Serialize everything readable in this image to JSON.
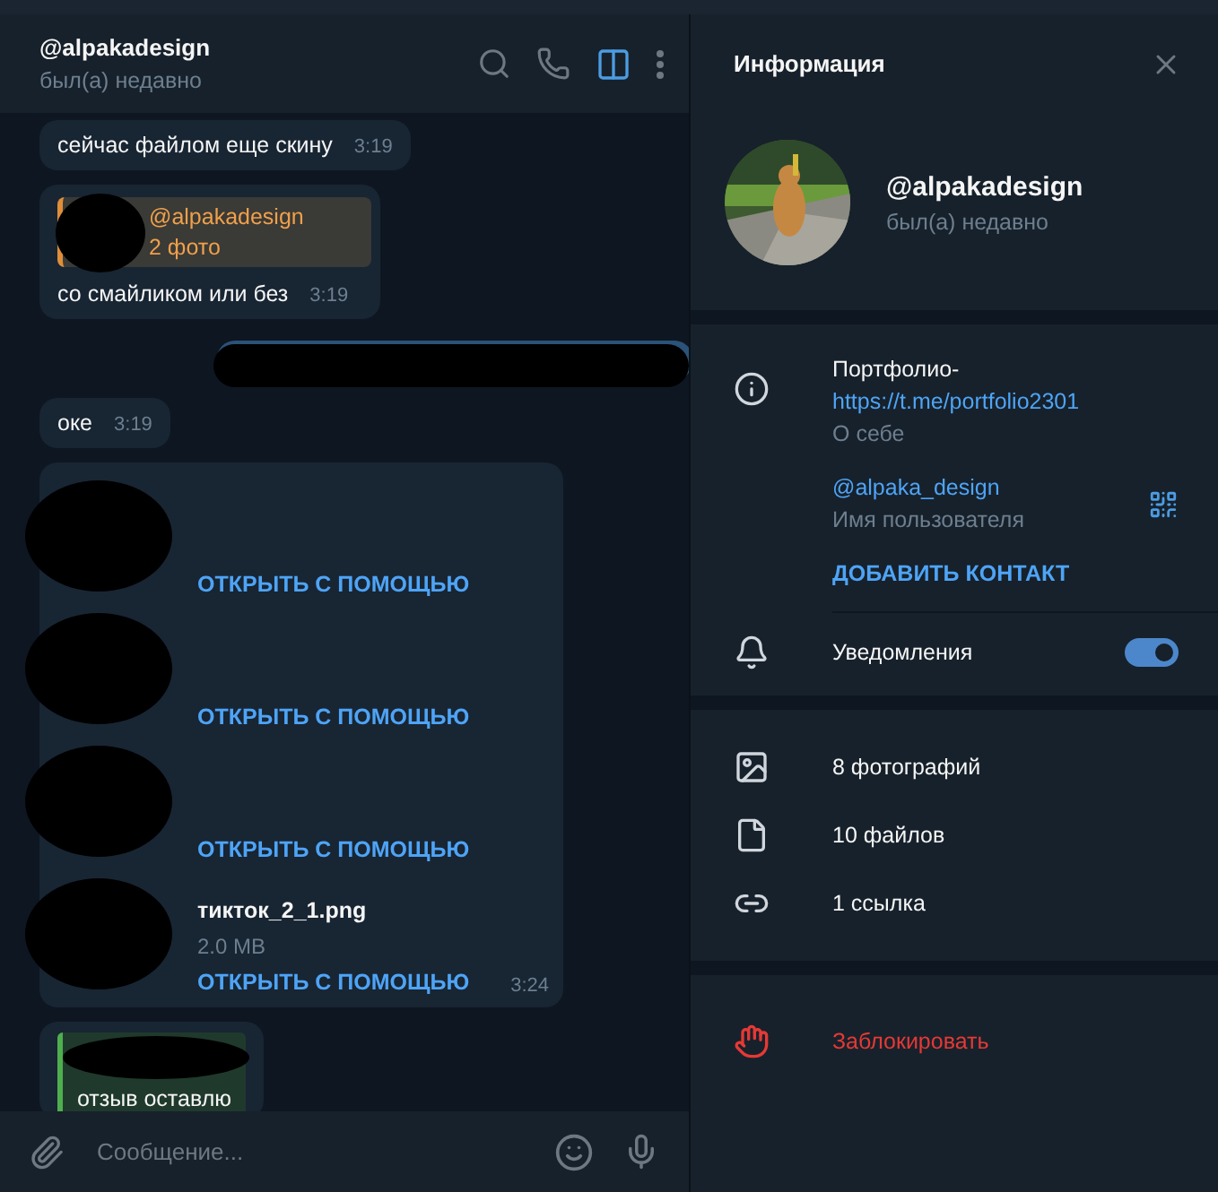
{
  "chat": {
    "title": "@alpakadesign",
    "status": "был(а) недавно",
    "messages": [
      {
        "kind": "text",
        "text": "сейчас файлом еще скину",
        "time": "3:19"
      },
      {
        "kind": "reply",
        "reply_author": "@alpakadesign",
        "reply_text": "2 фото",
        "text": "со смайликом или без",
        "time": "3:19"
      },
      {
        "kind": "outgoing_hidden"
      },
      {
        "kind": "text",
        "text": "оке",
        "time": "3:19"
      },
      {
        "kind": "files",
        "time": "3:24",
        "files": [
          {
            "action": "ОТКРЫТЬ С ПОМОЩЬЮ"
          },
          {
            "action": "ОТКРЫТЬ С ПОМОЩЬЮ"
          },
          {
            "action": "ОТКРЫТЬ С ПОМОЩЬЮ"
          },
          {
            "name": "тикток_2_1.png",
            "size": "2.0 MB",
            "action": "ОТКРЫТЬ С ПОМОЩЬЮ"
          }
        ]
      },
      {
        "kind": "quote",
        "text": "отзыв оставлю"
      }
    ]
  },
  "composer": {
    "placeholder": "Сообщение..."
  },
  "info_panel": {
    "title": "Информация",
    "name": "@alpakadesign",
    "status": "был(а) недавно",
    "bio": "Портфолио-",
    "bio_link": "https://t.me/portfolio2301",
    "bio_label": "О себе",
    "username": "@alpaka_design",
    "username_label": "Имя пользователя",
    "add_contact": "ДОБАВИТЬ КОНТАКТ",
    "notifications": {
      "label": "Уведомления",
      "on": true
    },
    "media": [
      {
        "kind": "photos",
        "label": "8 фотографий"
      },
      {
        "kind": "files",
        "label": "10 файлов"
      },
      {
        "kind": "links",
        "label": "1 ссылка"
      }
    ],
    "block": "Заблокировать"
  }
}
